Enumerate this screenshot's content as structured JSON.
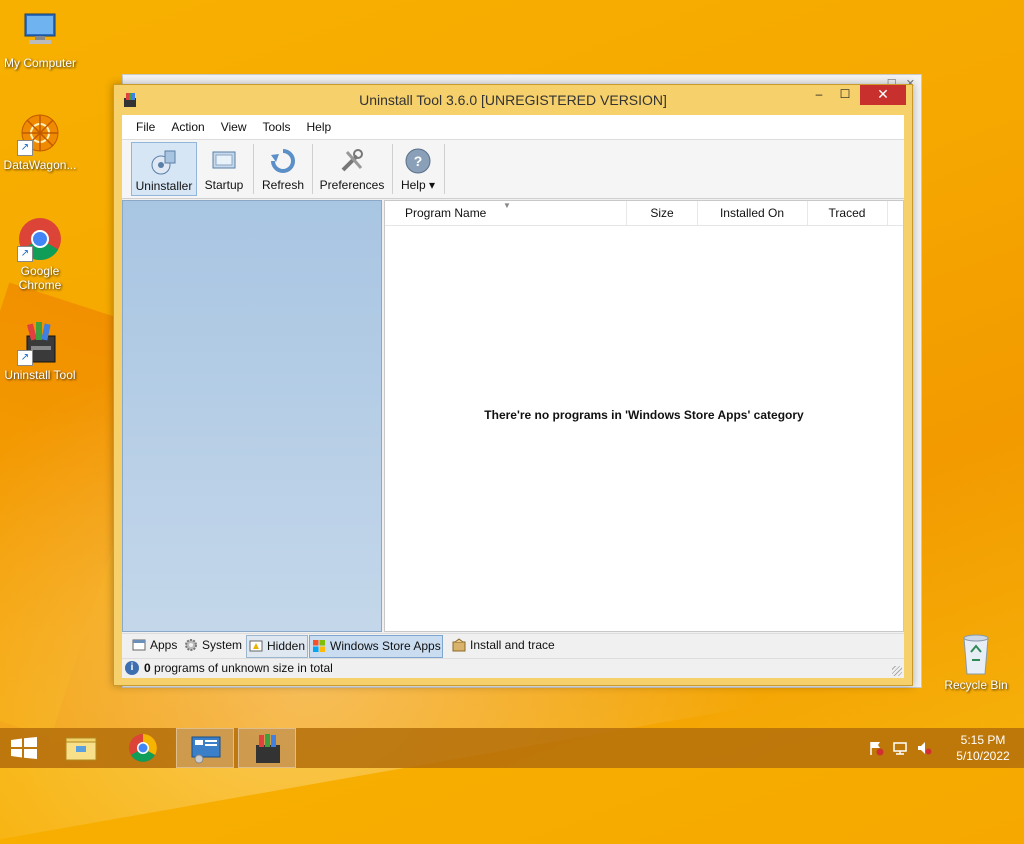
{
  "desktop": {
    "icons": [
      {
        "label": "My Computer",
        "icon": "computer-icon"
      },
      {
        "label": "DataWagon...",
        "icon": "datawagon-icon"
      },
      {
        "label": "Google Chrome",
        "icon": "chrome-icon"
      },
      {
        "label": "Uninstall Tool",
        "icon": "uninstall-tool-icon"
      }
    ],
    "recycle_bin": "Recycle Bin"
  },
  "window": {
    "title": "Uninstall Tool 3.6.0 [UNREGISTERED VERSION]",
    "min_glyph": "–",
    "max_glyph": "☐",
    "close_glyph": "✕",
    "menu": [
      "File",
      "Action",
      "View",
      "Tools",
      "Help"
    ],
    "toolbar": [
      {
        "label": "Uninstaller",
        "icon": "uninstaller-icon",
        "active": true
      },
      {
        "label": "Startup",
        "icon": "startup-icon"
      },
      {
        "label": "Refresh",
        "icon": "refresh-icon"
      },
      {
        "label": "Preferences",
        "icon": "preferences-icon"
      },
      {
        "label": "Help ▾",
        "icon": "help-icon"
      }
    ],
    "columns": [
      "Program Name",
      "Size",
      "Installed On",
      "Traced"
    ],
    "empty_message": "There're no programs in 'Windows Store Apps' category",
    "tabs": [
      {
        "label": "Apps",
        "icon": "apps-icon"
      },
      {
        "label": "System",
        "icon": "gear-icon"
      },
      {
        "label": "Hidden",
        "icon": "hidden-icon"
      },
      {
        "label": "Windows Store Apps",
        "icon": "windows-store-icon",
        "selected": true
      },
      {
        "label": "Install and trace",
        "icon": "install-trace-icon"
      }
    ],
    "status": {
      "count": "0",
      "text": "programs of unknown size in total"
    }
  },
  "taskbar": {
    "time": "5:15 PM",
    "date": "5/10/2022"
  }
}
